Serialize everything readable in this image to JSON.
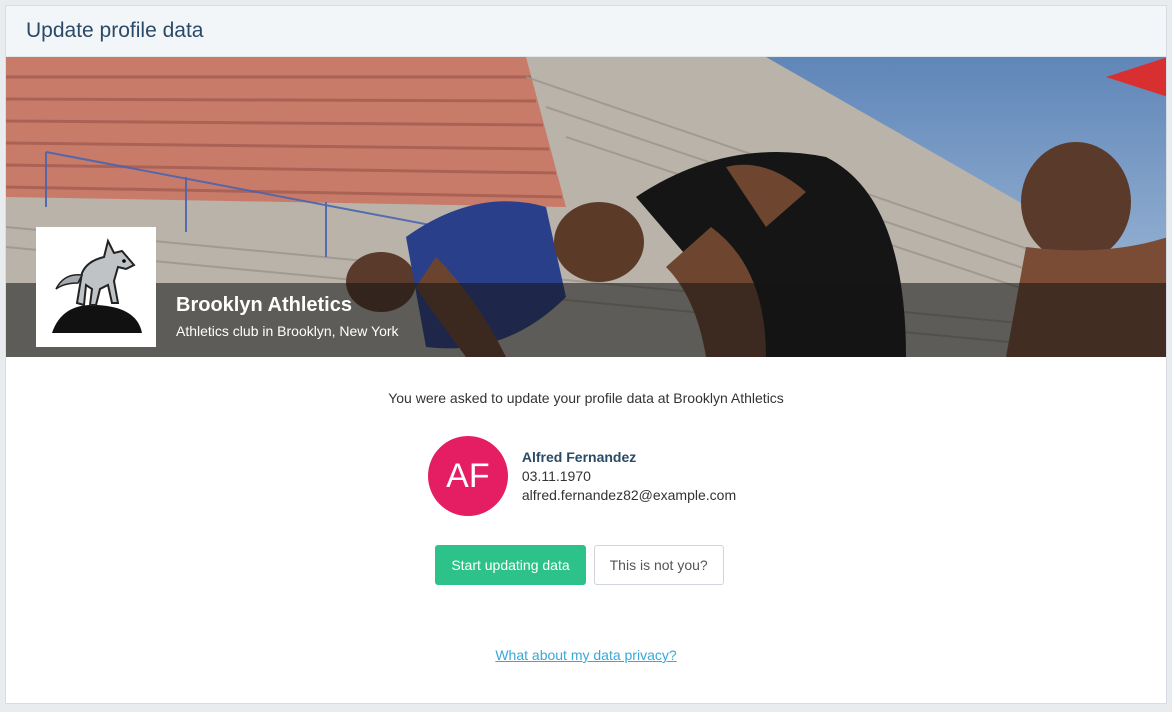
{
  "header": {
    "title": "Update profile data"
  },
  "club": {
    "name": "Brooklyn Athletics",
    "description": "Athletics club in Brooklyn, New York",
    "logo_icon": "wolf-logo-icon"
  },
  "intro_text": "You were asked to update your profile data at Brooklyn Athletics",
  "user": {
    "initials": "AF",
    "name": "Alfred Fernandez",
    "birthdate": "03.11.1970",
    "email": "alfred.fernandez82@example.com"
  },
  "actions": {
    "start_label": "Start updating data",
    "not_you_label": "This is not you?"
  },
  "privacy_link": "What about my data privacy?",
  "colors": {
    "primary": "#2dc289",
    "avatar": "#e51d62",
    "link": "#3aa7d8",
    "title": "#2a4a68"
  }
}
